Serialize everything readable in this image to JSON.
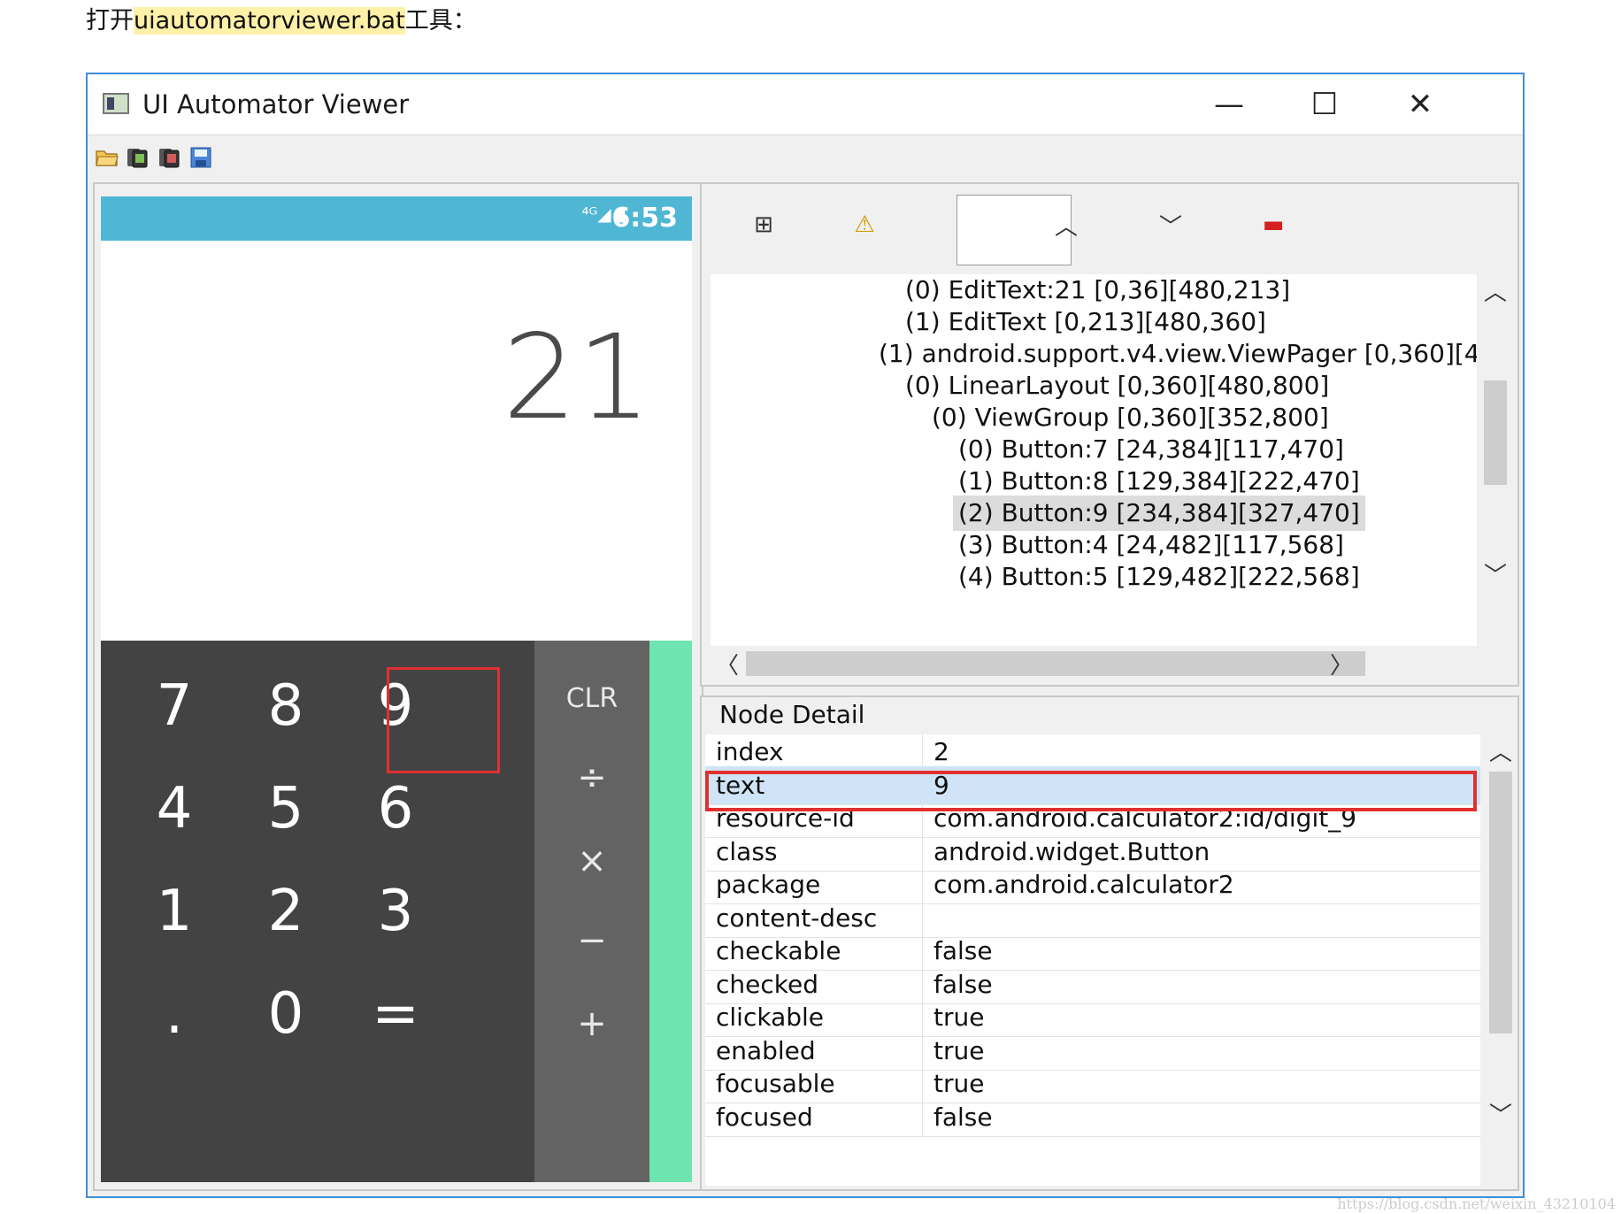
{
  "intro": {
    "prefix": "打开",
    "highlight": "uiautomatorviewer.bat",
    "suffix": "工具："
  },
  "window": {
    "title": "UI Automator Viewer",
    "minimize": "—",
    "maximize": "☐",
    "close": "✕"
  },
  "toolbar": {
    "icons": [
      "open-folder-icon",
      "device-screenshot-icon",
      "device-screenshot-compressed-icon",
      "save-icon"
    ]
  },
  "device": {
    "status_icons": "⁴ᴳ◢ ▮",
    "clock": "6:53",
    "display": "21",
    "keys": [
      "7",
      "8",
      "9",
      "4",
      "5",
      "6",
      "1",
      "2",
      "3",
      ".",
      "0",
      "="
    ],
    "ops": [
      "CLR",
      "÷",
      "×",
      "−",
      "+"
    ],
    "colors": {
      "statusbar": "#4fb6d4",
      "keypad": "#434343",
      "ops": "#636363",
      "accent": "#6ee4b0"
    }
  },
  "tree_toolbar": {
    "expand": "⊞",
    "warning": "⚠",
    "up": "︿",
    "down": "﹀",
    "remove": "▬"
  },
  "tree": [
    "(0) EditText:21 [0,36][480,213]",
    "(1) EditText [0,213][480,360]",
    "(1) android.support.v4.view.ViewPager [0,360][4",
    "(0) LinearLayout [0,360][480,800]",
    "(0) ViewGroup [0,360][352,800]",
    "(0) Button:7 [24,384][117,470]",
    "(1) Button:8 [129,384][222,470]",
    "(2) Button:9 [234,384][327,470]",
    "(3) Button:4 [24,482][117,568]",
    "(4) Button:5 [129,482][222,568]"
  ],
  "tree_selected_index": 7,
  "scroll_arrows": {
    "up": "︿",
    "down": "﹀",
    "left": "〈",
    "right": "〉"
  },
  "detail": {
    "title": "Node Detail",
    "rows": [
      {
        "k": "index",
        "v": "2"
      },
      {
        "k": "text",
        "v": "9"
      },
      {
        "k": "resource-id",
        "v": "com.android.calculator2:id/digit_9"
      },
      {
        "k": "class",
        "v": "android.widget.Button"
      },
      {
        "k": "package",
        "v": "com.android.calculator2"
      },
      {
        "k": "content-desc",
        "v": ""
      },
      {
        "k": "checkable",
        "v": "false"
      },
      {
        "k": "checked",
        "v": "false"
      },
      {
        "k": "clickable",
        "v": "true"
      },
      {
        "k": "enabled",
        "v": "true"
      },
      {
        "k": "focusable",
        "v": "true"
      },
      {
        "k": "focused",
        "v": "false"
      }
    ],
    "selected_index": 1
  },
  "watermark": "https://blog.csdn.net/weixin_43210104"
}
